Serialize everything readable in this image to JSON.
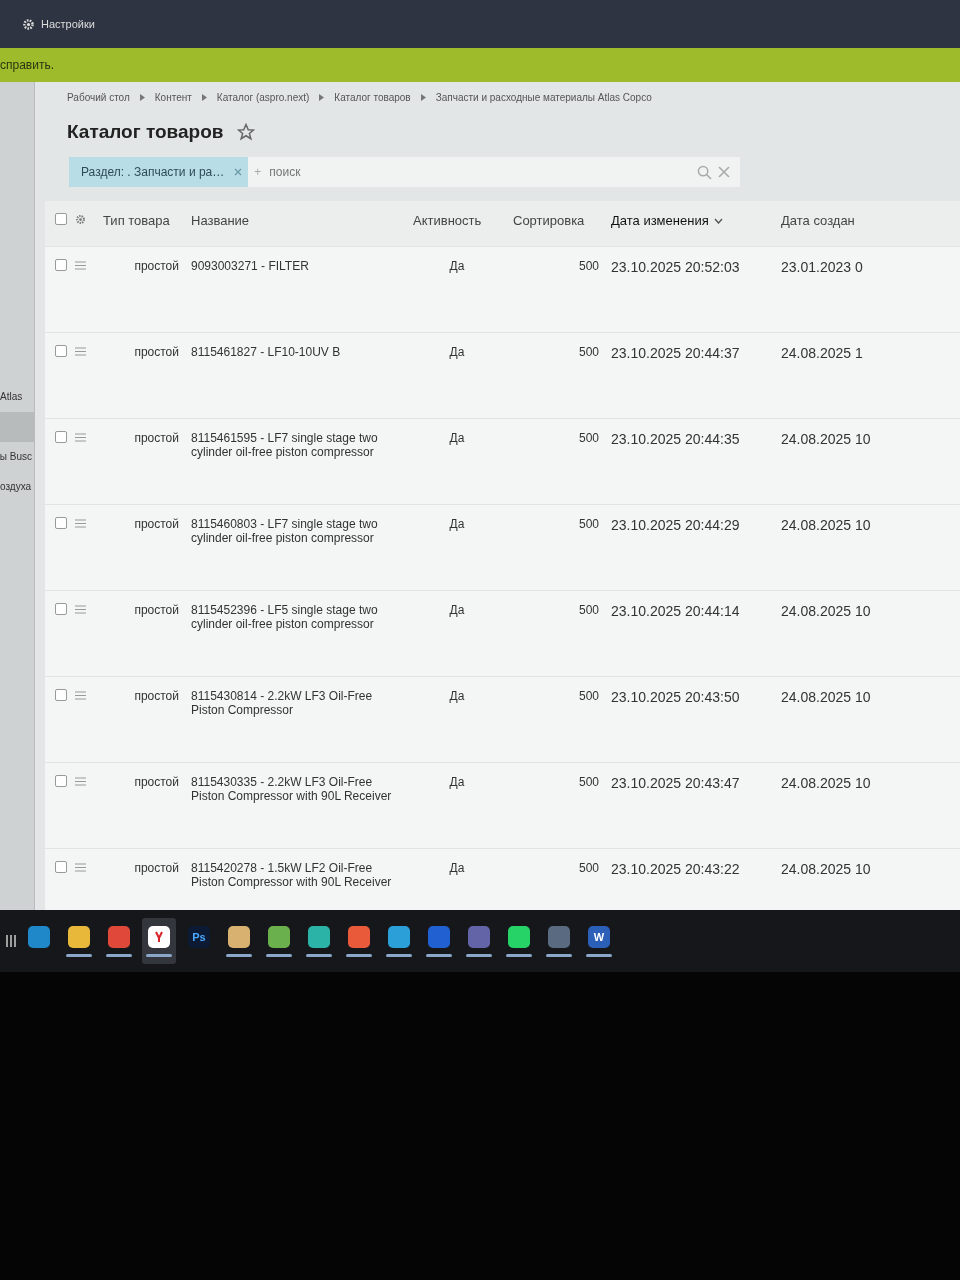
{
  "top_bar": {
    "settings_label": "Настройки"
  },
  "notice_bar": {
    "text": "справить."
  },
  "sidebar": {
    "items": [
      {
        "label": "Atlas",
        "selected": false
      },
      {
        "selected": true
      },
      {
        "label": "ы Busc",
        "selected": false
      },
      {
        "label": "оздуха",
        "selected": false
      }
    ]
  },
  "breadcrumbs": [
    "Рабочий стол",
    "Контент",
    "Каталог (aspro.next)",
    "Каталог товаров",
    "Запчасти и расходные материалы Atlas Copco"
  ],
  "page_title": "Каталог товаров",
  "filter": {
    "chip": "Раздел: . Запчасти и ра…",
    "placeholder": "поиск",
    "add_mark": "+"
  },
  "table": {
    "header_checked": false,
    "columns": [
      {
        "label": "Тип товара",
        "sorted": false
      },
      {
        "label": "Название",
        "sorted": false
      },
      {
        "label": "Активность",
        "sorted": false
      },
      {
        "label": "Сортировка",
        "sorted": false
      },
      {
        "label": "Дата изменения",
        "sorted": true
      },
      {
        "label": "Дата создан",
        "sorted": false
      }
    ],
    "rows": [
      {
        "checked": false,
        "type": "простой",
        "name": "9093003271 - FILTER",
        "active": "Да",
        "sort": "500",
        "modified": "23.10.2025 20:52:03",
        "created": "23.01.2023 0"
      },
      {
        "checked": false,
        "type": "простой",
        "name": "8115461827 - LF10-10UV B",
        "active": "Да",
        "sort": "500",
        "modified": "23.10.2025 20:44:37",
        "created": "24.08.2025 1"
      },
      {
        "checked": false,
        "type": "простой",
        "name": "8115461595 - LF7 single stage two cylinder oil-free piston compressor",
        "active": "Да",
        "sort": "500",
        "modified": "23.10.2025 20:44:35",
        "created": "24.08.2025 10"
      },
      {
        "checked": false,
        "type": "простой",
        "name": "8115460803 - LF7 single stage two cylinder oil-free piston compressor",
        "active": "Да",
        "sort": "500",
        "modified": "23.10.2025 20:44:29",
        "created": "24.08.2025 10"
      },
      {
        "checked": false,
        "type": "простой",
        "name": "8115452396 - LF5 single stage two cylinder oil-free piston compressor",
        "active": "Да",
        "sort": "500",
        "modified": "23.10.2025 20:44:14",
        "created": "24.08.2025 10"
      },
      {
        "checked": false,
        "type": "простой",
        "name": "8115430814 - 2.2kW LF3 Oil-Free Piston Compressor",
        "active": "Да",
        "sort": "500",
        "modified": "23.10.2025 20:43:50",
        "created": "24.08.2025 10"
      },
      {
        "checked": false,
        "type": "простой",
        "name": "8115430335 - 2.2kW LF3 Oil-Free Piston Compressor with 90L Receiver",
        "active": "Да",
        "sort": "500",
        "modified": "23.10.2025 20:43:47",
        "created": "24.08.2025 10"
      },
      {
        "checked": false,
        "type": "простой",
        "name": "8115420278 - 1.5kW LF2 Oil-Free Piston Compressor with 90L Receiver",
        "active": "Да",
        "sort": "500",
        "modified": "23.10.2025 20:43:22",
        "created": "24.08.2025 10"
      }
    ]
  },
  "taskbar": {
    "apps": [
      {
        "kind": "browser-e",
        "running": false,
        "selected": false
      },
      {
        "kind": "folder",
        "running": true,
        "selected": false
      },
      {
        "kind": "design",
        "running": true,
        "selected": false
      },
      {
        "kind": "browser-y",
        "running": true,
        "selected": true
      },
      {
        "kind": "ps",
        "label": "Ps",
        "running": false,
        "selected": false
      },
      {
        "kind": "lock",
        "running": true,
        "selected": false
      },
      {
        "kind": "torrent",
        "running": true,
        "selected": false
      },
      {
        "kind": "bug",
        "running": true,
        "selected": false
      },
      {
        "kind": "redapp",
        "running": true,
        "selected": false
      },
      {
        "kind": "telegram",
        "running": true,
        "selected": false
      },
      {
        "kind": "cloud",
        "running": true,
        "selected": false
      },
      {
        "kind": "teams",
        "running": true,
        "selected": false
      },
      {
        "kind": "whatsapp",
        "running": true,
        "selected": false
      },
      {
        "kind": "calculator",
        "running": true,
        "selected": false
      },
      {
        "kind": "word",
        "label": "W",
        "running": true,
        "selected": false
      }
    ]
  }
}
